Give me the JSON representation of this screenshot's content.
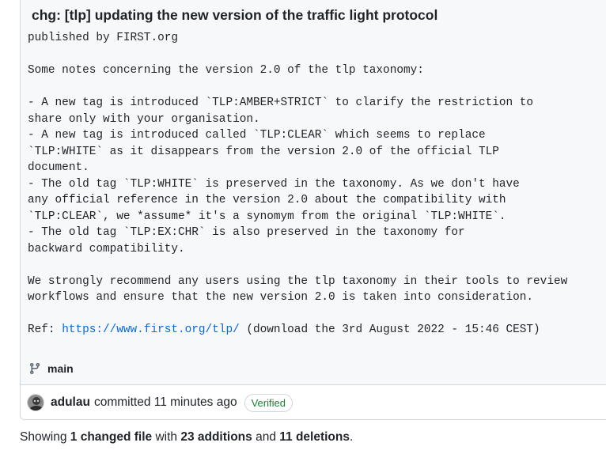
{
  "commit": {
    "title": "chg: [tlp] updating the new version of the traffic light protocol",
    "description_lines": [
      "published by FIRST.org",
      "",
      "Some notes concerning the version 2.0 of the tlp taxonomy:",
      "",
      "- A new tag is introduced `TLP:AMBER+STRICT` to clarify the restriction to",
      "share only with your organisation.",
      "- A new tag is introduced called `TLP:CLEAR` which seems to replace",
      "`TLP:WHITE` as it disappears from the version 2.0 of the official TLP",
      "document.",
      "- The old tag `TLP:WHITE` is preserved in the taxonomy. As we don't have",
      "any official reference in the version 2.0 about the compatibility with",
      "`TLP:CLEAR`, we *assume* it's a synomym from the original `TLP:WHITE`.",
      "- The old tag `TLP:EX:CHR` is also preserved in the taxonomy for",
      "backward compatibility.",
      "",
      "We strongly recommend any users using the tlp taxonomy in their tools to review",
      "workflows and ensure that the new version 2.0 is taken into consideration.",
      ""
    ],
    "ref_prefix": "Ref: ",
    "ref_link": "https://www.first.org/tlp/",
    "ref_suffix": " (download the 3rd August 2022 - 15:46 CEST)",
    "branch": "main",
    "branch_icon": "git-branch-icon",
    "author": "adulau",
    "committed_text": "committed 11 minutes ago",
    "verified_label": "Verified",
    "colors": {
      "link": "#0969da",
      "verified": "#1a7f37",
      "border": "#d0d7de",
      "panel_bg": "#f6f8fa"
    }
  },
  "summary": {
    "prefix": "Showing ",
    "changed": "1 changed file",
    "with": " with ",
    "additions": "23 additions",
    "and": " and ",
    "deletions": "11 deletions",
    "suffix": "."
  }
}
